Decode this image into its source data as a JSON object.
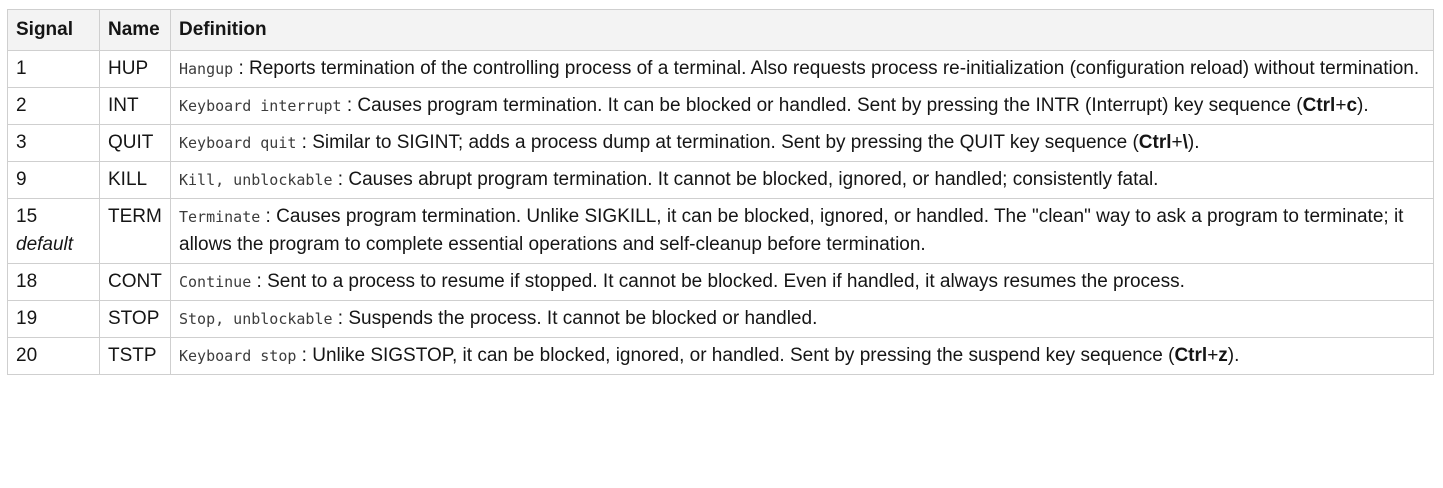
{
  "table": {
    "headers": [
      "Signal",
      "Name",
      "Definition"
    ],
    "rows": [
      {
        "signal": "1",
        "note": "",
        "name": "HUP",
        "term": "Hangup",
        "text": " : Reports termination of the controlling process of a terminal. Also requests process re-initialization (configuration reload) without termination.",
        "pre": "",
        "key1": "",
        "mid": "",
        "key2": "",
        "post": ""
      },
      {
        "signal": "2",
        "note": "",
        "name": "INT",
        "term": "Keyboard interrupt",
        "text": " : Causes program termination. It can be blocked or handled. Sent by pressing the INTR (Interrupt) key sequence (",
        "pre": "",
        "key1": "Ctrl",
        "mid": "+",
        "key2": "c",
        "post": ")."
      },
      {
        "signal": "3",
        "note": "",
        "name": "QUIT",
        "term": "Keyboard quit",
        "text": " : Similar to SIGINT; adds a process dump at termination. Sent by pressing the QUIT key sequence (",
        "pre": "",
        "key1": "Ctrl",
        "mid": "+",
        "key2": "\\",
        "post": ")."
      },
      {
        "signal": "9",
        "note": "",
        "name": "KILL",
        "term": "Kill, unblockable",
        "text": " : Causes abrupt program termination. It cannot be blocked, ignored, or handled; consistently fatal.",
        "pre": "",
        "key1": "",
        "mid": "",
        "key2": "",
        "post": ""
      },
      {
        "signal": "15",
        "note": "default",
        "name": "TERM",
        "term": "Terminate",
        "text": " : Causes program termination. Unlike SIGKILL, it can be blocked, ignored, or handled. The \"clean\" way to ask a program to terminate; it allows the program to complete essential operations and self-cleanup before termination.",
        "pre": "",
        "key1": "",
        "mid": "",
        "key2": "",
        "post": ""
      },
      {
        "signal": "18",
        "note": "",
        "name": "CONT",
        "term": "Continue",
        "text": " : Sent to a process to resume if stopped. It cannot be blocked. Even if handled, it always resumes the process.",
        "pre": "",
        "key1": "",
        "mid": "",
        "key2": "",
        "post": ""
      },
      {
        "signal": "19",
        "note": "",
        "name": "STOP",
        "term": "Stop, unblockable",
        "text": " : Suspends the process. It cannot be blocked or handled.",
        "pre": "",
        "key1": "",
        "mid": "",
        "key2": "",
        "post": ""
      },
      {
        "signal": "20",
        "note": "",
        "name": "TSTP",
        "term": "Keyboard stop",
        "text": " : Unlike SIGSTOP, it can be blocked, ignored, or handled. Sent by pressing the suspend key sequence (",
        "pre": "",
        "key1": "Ctrl",
        "mid": "+",
        "key2": "z",
        "post": ")."
      }
    ]
  }
}
